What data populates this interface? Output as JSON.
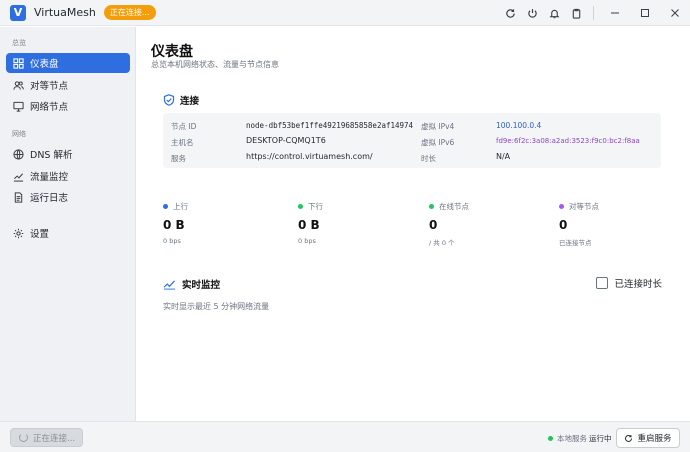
{
  "app": {
    "logo_letter": "V",
    "title": "VirtuaMesh",
    "status_pill": "正在连接..."
  },
  "sidebar": {
    "sections": [
      "总览",
      "网络"
    ],
    "items": [
      {
        "label": "仪表盘",
        "icon": "dashboard-icon"
      },
      {
        "label": "对等节点",
        "icon": "users-icon"
      },
      {
        "label": "网络节点",
        "icon": "monitor-icon"
      },
      {
        "label": "DNS 解析",
        "icon": "globe-icon"
      },
      {
        "label": "流量监控",
        "icon": "chart-line-icon"
      },
      {
        "label": "运行日志",
        "icon": "log-icon"
      },
      {
        "label": "设置",
        "icon": "gear-icon"
      }
    ]
  },
  "page": {
    "title": "仪表盘",
    "subtitle": "总览本机网络状态、流量与节点信息"
  },
  "connection": {
    "heading": "连接",
    "fields": [
      {
        "label": "节点 ID",
        "value": "node-dbf53bef1ffe49219685858e2af14974"
      },
      {
        "label": "主机名",
        "value": "DESKTOP-CQMQ1T6"
      },
      {
        "label": "服务",
        "value": "https://control.virtuamesh.com/"
      },
      {
        "label": "虚拟 IPv4",
        "value": "100.100.0.4"
      },
      {
        "label": "虚拟 IPv6",
        "value": "fd9e:6f2c:3a08:a2ad:3523:f9c0:bc2:f8aa"
      },
      {
        "label": "时长",
        "value": "N/A"
      }
    ]
  },
  "stats": [
    {
      "label": "上行",
      "value": "0 B",
      "sub": "0 bps",
      "color": "#2f6ee0"
    },
    {
      "label": "下行",
      "value": "0 B",
      "sub": "0 bps",
      "color": "#22c55e"
    },
    {
      "label": "在线节点",
      "value": "0",
      "sub": "/ 共 0 个",
      "color": "#22c55e"
    },
    {
      "label": "对等节点",
      "value": "0",
      "sub": "已连接节点",
      "color": "#a855f7"
    }
  ],
  "monitor": {
    "heading": "实时监控",
    "toggle_label": "已连接时长",
    "description": "实时显示最近 5 分钟网络流量"
  },
  "footer": {
    "connecting_button": "正在连接...",
    "local_service": "本地服务",
    "running": "运行中",
    "restart_button": "重启服务"
  },
  "colors": {
    "accent": "#2f6ee0",
    "pill": "#f59e0b",
    "ipv6": "#8b45c8",
    "online": "#22c55e"
  }
}
